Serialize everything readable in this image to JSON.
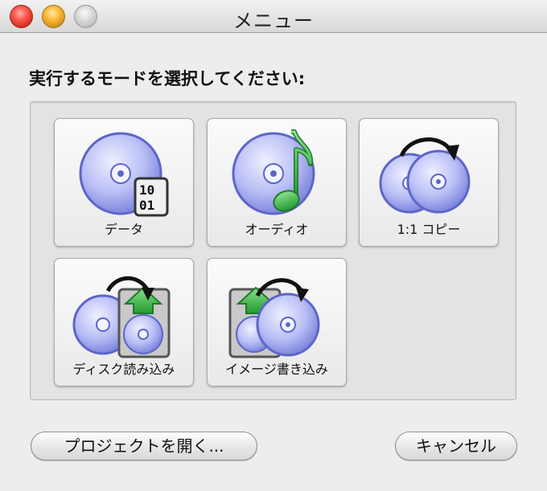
{
  "window": {
    "title": "メニュー"
  },
  "prompt": "実行するモードを選択してください:",
  "modes": [
    {
      "label": "データ",
      "icon": "data-disc-icon"
    },
    {
      "label": "オーディオ",
      "icon": "audio-disc-icon"
    },
    {
      "label": "1:1 コピー",
      "icon": "disc-copy-icon"
    },
    {
      "label": "ディスク読み込み",
      "icon": "disc-read-icon"
    },
    {
      "label": "イメージ書き込み",
      "icon": "image-write-icon"
    }
  ],
  "buttons": {
    "open_project": "プロジェクトを開く...",
    "cancel": "キャンセル"
  },
  "colors": {
    "disc": "#b9bef5",
    "disc_dark": "#5d66c9",
    "arrow": "#111111",
    "green": "#39b84a"
  }
}
